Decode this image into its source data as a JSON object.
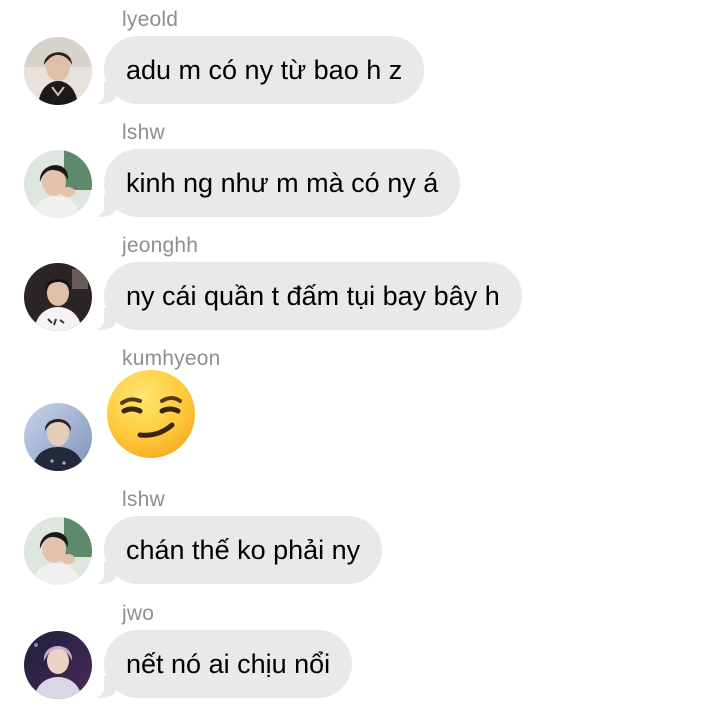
{
  "messages": [
    {
      "sender": "lyeold",
      "text": "adu m có ny từ bao h z",
      "avatar": "avatar-photo-1"
    },
    {
      "sender": "lshw",
      "text": "kinh ng như m mà có ny á",
      "avatar": "avatar-photo-2"
    },
    {
      "sender": "jeonghh",
      "text": "ny cái quần t đấm tụi bay bây h",
      "avatar": "avatar-photo-3"
    },
    {
      "sender": "kumhyeon",
      "emoji": "smirking-face-emoji",
      "avatar": "avatar-photo-4"
    },
    {
      "sender": "lshw",
      "text": "chán thế ko phải ny",
      "avatar": "avatar-photo-2"
    },
    {
      "sender": "jwo",
      "text": "nết nó ai chịu nổi",
      "avatar": "avatar-photo-5"
    }
  ],
  "colors": {
    "bubble_bg": "#e9e9eb",
    "sender_text": "#8e8e93",
    "message_text": "#000000",
    "background": "#ffffff"
  }
}
